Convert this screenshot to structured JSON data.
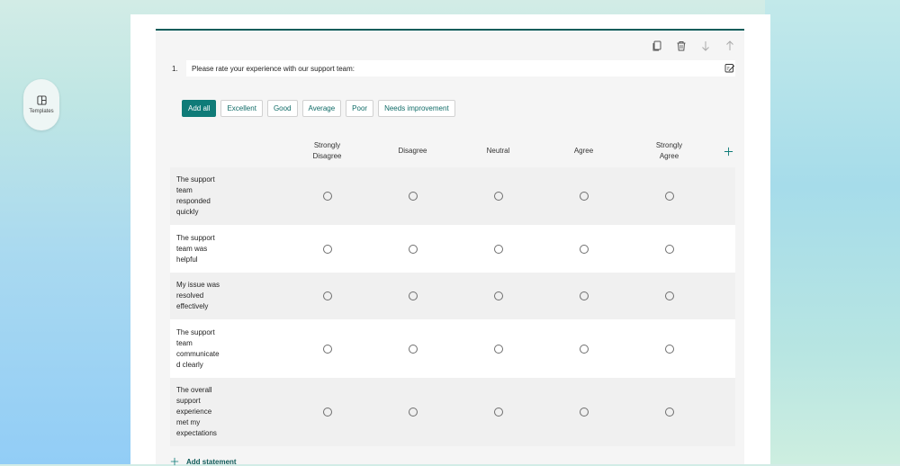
{
  "sidebar": {
    "templates_label": "Templates"
  },
  "toolbar": {
    "icons": [
      "copy-icon",
      "delete-icon",
      "move-down-icon",
      "move-up-icon"
    ]
  },
  "question": {
    "number": "1.",
    "text": "Please rate your experience with our support team:",
    "edit_icon": "edit-note-icon"
  },
  "chips": [
    {
      "label": "Add all",
      "primary": true
    },
    {
      "label": "Excellent"
    },
    {
      "label": "Good"
    },
    {
      "label": "Average"
    },
    {
      "label": "Poor"
    },
    {
      "label": "Needs improvement"
    }
  ],
  "table": {
    "columns": [
      [
        "Strongly",
        "Disagree"
      ],
      [
        "Disagree"
      ],
      [
        "Neutral"
      ],
      [
        "Agree"
      ],
      [
        "Strongly",
        "Agree"
      ]
    ],
    "rows": [
      {
        "lines": [
          "The support",
          "team",
          "responded",
          "quickly"
        ]
      },
      {
        "lines": [
          "The support",
          "team was",
          "helpful"
        ]
      },
      {
        "lines": [
          "My issue was",
          "resolved",
          "effectively"
        ]
      },
      {
        "lines": [
          "The support",
          "team",
          "communicate",
          "d clearly"
        ]
      },
      {
        "lines": [
          "The overall",
          "support",
          "experience",
          "met my",
          "expectations"
        ]
      }
    ]
  },
  "footer": {
    "add_statement_label": "Add statement"
  },
  "colors": {
    "accent": "#0f7b78",
    "accent_dark": "#0f5c5a"
  }
}
